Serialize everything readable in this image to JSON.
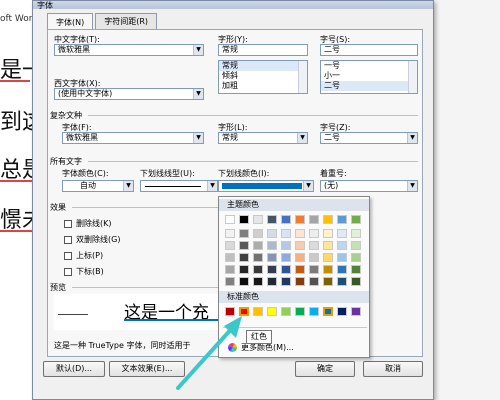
{
  "window": {
    "title": "字体",
    "behind_app": "oft Wor"
  },
  "background_text": [
    "是一",
    "到这",
    "总是",
    "憬未"
  ],
  "tabs": [
    {
      "label": "字体(N)"
    },
    {
      "label": "字符间距(R)"
    }
  ],
  "fields": {
    "chinese_font_label": "中文字体(T):",
    "chinese_font_value": "微软雅黑",
    "style_label": "字形(Y):",
    "style_value": "常规",
    "size_label": "字号(S):",
    "size_value": "二号",
    "western_font_label": "西文字体(X):",
    "western_font_value": "(使用中文字体)",
    "style_list": [
      "常规",
      "倾斜",
      "加粗"
    ],
    "size_list": [
      "一号",
      "小一",
      "二号"
    ]
  },
  "complex": {
    "heading": "复杂文种",
    "font_label": "字体(F):",
    "font_value": "微软雅黑",
    "style_label": "字形(L):",
    "style_value": "常规",
    "size_label": "字号(Z):",
    "size_value": "二号"
  },
  "all_text": {
    "heading": "所有文字",
    "color_label": "字体颜色(C):",
    "color_value": "自动",
    "underline_label": "下划线线型(U):",
    "underline_color_label": "下划线颜色(I):",
    "emphasis_label": "着重号:",
    "emphasis_value": "(无)"
  },
  "effects": {
    "heading": "效果",
    "items": [
      "删除线(K)",
      "双删除线(G)",
      "上标(P)",
      "下标(B)"
    ]
  },
  "preview": {
    "heading": "预览",
    "sample": "这是一个充",
    "note": "这是一种 TrueType 字体，同时适用于"
  },
  "buttons": {
    "default": "默认(D)...",
    "text_effects": "文本效果(E)...",
    "ok": "确定",
    "cancel": "取消"
  },
  "color_popup": {
    "theme_heading": "主题颜色",
    "standard_heading": "标准颜色",
    "tooltip": "红色",
    "more_colors": "更多颜色(M)...",
    "theme_top_row": [
      "#ffffff",
      "#000000",
      "#e7e6e6",
      "#44546a",
      "#4472c4",
      "#ed7d31",
      "#a5a5a5",
      "#ffc000",
      "#5b9bd5",
      "#70ad47"
    ],
    "theme_shades": [
      [
        "#f2f2f2",
        "#7f7f7f",
        "#d0cece",
        "#d6dce5",
        "#dae3f3",
        "#fbe5d6",
        "#ededed",
        "#fff2cc",
        "#deebf7",
        "#e2f0d9"
      ],
      [
        "#d9d9d9",
        "#595959",
        "#aeabab",
        "#adb9ca",
        "#b4c7e7",
        "#f8cbad",
        "#dbdbdb",
        "#ffe699",
        "#bdd7ee",
        "#c5e0b4"
      ],
      [
        "#bfbfbf",
        "#404040",
        "#757171",
        "#8497b0",
        "#8faadc",
        "#f4b183",
        "#c9c9c9",
        "#ffd966",
        "#9dc3e6",
        "#a9d18e"
      ],
      [
        "#a6a6a6",
        "#262626",
        "#3b3838",
        "#333f50",
        "#2f5597",
        "#c55a11",
        "#7b7b7b",
        "#bf9000",
        "#2e75b6",
        "#538135"
      ],
      [
        "#808080",
        "#0d0d0d",
        "#171717",
        "#222a35",
        "#1f3864",
        "#843c0c",
        "#525252",
        "#7f6000",
        "#1f4e79",
        "#385723"
      ]
    ],
    "standard": [
      "#c00000",
      "#ff0000",
      "#ffc000",
      "#ffff00",
      "#92d050",
      "#00b050",
      "#00b0f0",
      "#0070c0",
      "#002060",
      "#7030a0"
    ]
  }
}
